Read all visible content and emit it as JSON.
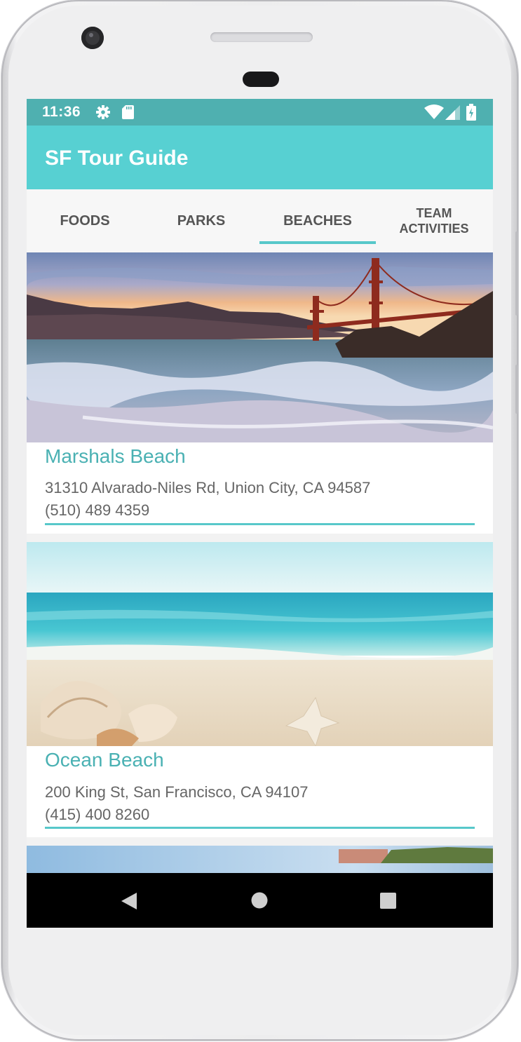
{
  "status_bar": {
    "time": "11:36",
    "icons": [
      "settings-icon",
      "sd-card-icon",
      "wifi-icon",
      "signal-icon",
      "battery-icon"
    ]
  },
  "app_bar": {
    "title": "SF Tour Guide"
  },
  "tabs": [
    {
      "label": "FOODS",
      "selected": false
    },
    {
      "label": "PARKS",
      "selected": false
    },
    {
      "label": "BEACHES",
      "selected": true
    },
    {
      "label": "TEAM\nACTIVITIES",
      "selected": false
    }
  ],
  "beaches": [
    {
      "name": "Marshals Beach",
      "address": "31310 Alvarado-Niles Rd, Union City, CA 94587",
      "phone": "(510) 489 4359"
    },
    {
      "name": "Ocean Beach",
      "address": "200 King St, San Francisco, CA 94107",
      "phone": "(415) 400 8260"
    }
  ],
  "colors": {
    "primary": "#57D0D2",
    "primary_dark": "#4FB0B0",
    "accent": "#57C8CA",
    "title_text": "#4AB1B3"
  },
  "nav_bar": {
    "icons": [
      "back-icon",
      "home-icon",
      "recents-icon"
    ]
  }
}
